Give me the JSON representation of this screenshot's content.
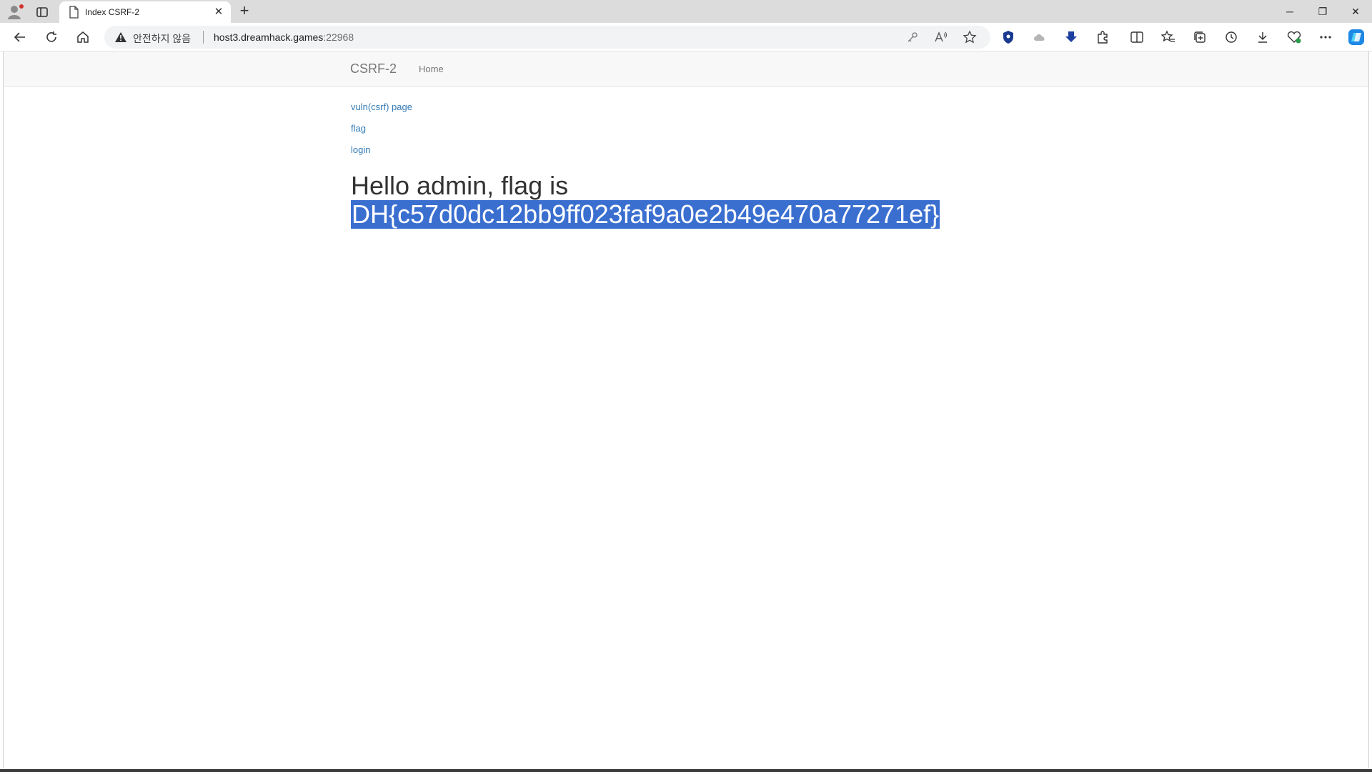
{
  "browser": {
    "tab_title": "Index CSRF-2",
    "tab_close": "✕",
    "new_tab": "+",
    "window_controls": {
      "minimize": "─",
      "restore": "❐",
      "close": "✕"
    },
    "address": {
      "security_text": "안전하지 않음",
      "host": "host3.dreamhack.games",
      "port": ":22968"
    },
    "toolbar_icons": [
      "back-icon",
      "refresh-icon",
      "home-icon",
      "key-icon",
      "read-aloud-icon",
      "favorite-star-icon",
      "shield-extension-icon",
      "cloud-extension-icon",
      "download-arrow-extension-icon",
      "extensions-icon",
      "split-screen-icon",
      "favorites-icon",
      "collections-icon",
      "history-icon",
      "downloads-icon",
      "performance-icon",
      "more-menu-icon",
      "copilot-icon"
    ],
    "colors": {
      "accent": "#3a6fd0",
      "tab_strip": "#dcdcdc",
      "link": "#337ab7"
    }
  },
  "site": {
    "brand": "CSRF-2",
    "nav_home": "Home",
    "links": [
      "vuln(csrf) page",
      "flag",
      "login"
    ],
    "greeting": "Hello admin, flag is",
    "flag_value": "DH{c57d0dc12bb9ff023faf9a0e2b49e470a77271ef}"
  }
}
